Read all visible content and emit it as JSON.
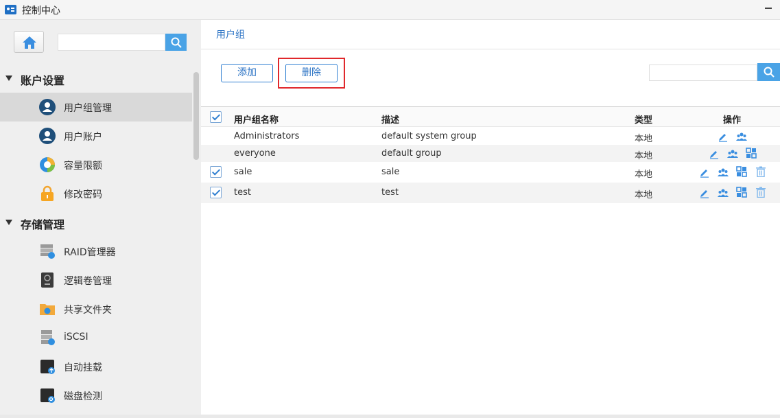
{
  "window": {
    "title": "控制中心"
  },
  "sidebar": {
    "search_placeholder": "",
    "sections": [
      {
        "label": "账户设置",
        "items": [
          {
            "label": "用户组管理",
            "icon": "user-group-icon",
            "active": true
          },
          {
            "label": "用户账户",
            "icon": "user-account-icon"
          },
          {
            "label": "容量限额",
            "icon": "quota-pie-icon"
          },
          {
            "label": "修改密码",
            "icon": "lock-icon"
          }
        ]
      },
      {
        "label": "存储管理",
        "items": [
          {
            "label": "RAID管理器",
            "icon": "raid-icon"
          },
          {
            "label": "逻辑卷管理",
            "icon": "logical-volume-icon"
          },
          {
            "label": "共享文件夹",
            "icon": "shared-folder-icon"
          },
          {
            "label": "iSCSI",
            "icon": "iscsi-icon"
          },
          {
            "label": "自动挂载",
            "icon": "auto-mount-icon"
          },
          {
            "label": "磁盘检测",
            "icon": "disk-check-icon"
          }
        ]
      }
    ]
  },
  "main": {
    "breadcrumb": "用户组",
    "toolbar": {
      "add_label": "添加",
      "delete_label": "删除",
      "search_placeholder": ""
    },
    "table": {
      "columns": [
        "用户组名称",
        "描述",
        "类型",
        "操作"
      ],
      "rows": [
        {
          "name": "Administrators",
          "description": "default system group",
          "type": "本地",
          "checkbox": false,
          "actions": [
            "edit-icon",
            "members-icon"
          ]
        },
        {
          "name": "everyone",
          "description": "default group",
          "type": "本地",
          "checkbox": false,
          "actions": [
            "edit-icon",
            "members-icon",
            "permissions-icon"
          ]
        },
        {
          "name": "sale",
          "description": "sale",
          "type": "本地",
          "checkbox": true,
          "actions": [
            "edit-icon",
            "members-icon",
            "permissions-icon",
            "trash-icon"
          ]
        },
        {
          "name": "test",
          "description": "test",
          "type": "本地",
          "checkbox": true,
          "actions": [
            "edit-icon",
            "members-icon",
            "permissions-icon",
            "trash-icon"
          ]
        }
      ]
    }
  },
  "colors": {
    "accent": "#2a72c4",
    "search_button": "#4aa3e6",
    "highlight": "#e0282c"
  }
}
